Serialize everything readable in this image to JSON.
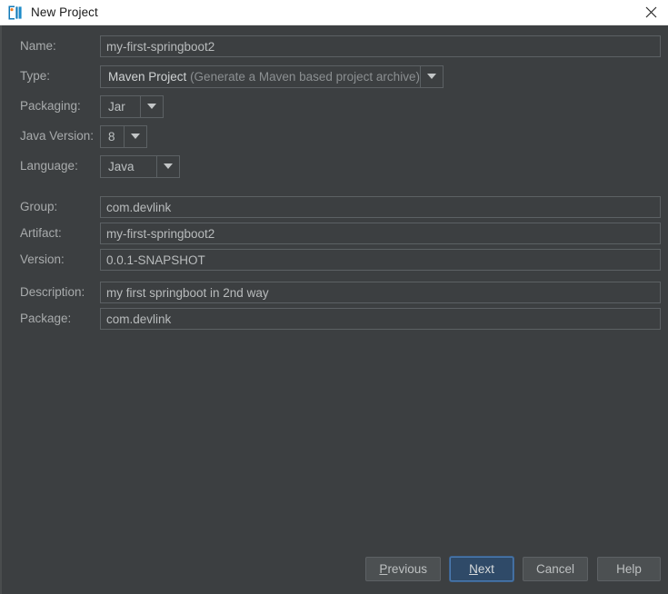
{
  "window": {
    "title": "New Project",
    "logo_icon": "intellij-idea-logo",
    "close_icon": "close-icon"
  },
  "form": {
    "fields": [
      {
        "id": "name",
        "label": "Name:",
        "kind": "text",
        "value": "my-first-springboot2",
        "placeholder": ""
      },
      {
        "id": "type",
        "label": "Type:",
        "kind": "combo",
        "value": "Maven Project",
        "value_hint": "(Generate a Maven based project archive)",
        "arrow_icon": "chevron-down-icon"
      },
      {
        "id": "packaging",
        "label": "Packaging:",
        "kind": "combo",
        "value": "Jar",
        "arrow_icon": "chevron-down-icon"
      },
      {
        "id": "java_version",
        "label": "Java Version:",
        "kind": "combo",
        "value": "8",
        "arrow_icon": "chevron-down-icon"
      },
      {
        "id": "language",
        "label": "Language:",
        "kind": "combo",
        "value": "Java",
        "arrow_icon": "chevron-down-icon"
      },
      {
        "id": "group",
        "label": "Group:",
        "kind": "text",
        "value": "com.devlink",
        "placeholder": ""
      },
      {
        "id": "artifact",
        "label": "Artifact:",
        "kind": "text",
        "value": "my-first-springboot2",
        "placeholder": ""
      },
      {
        "id": "version",
        "label": "Version:",
        "kind": "text",
        "value": "0.0.1-SNAPSHOT",
        "placeholder": ""
      },
      {
        "id": "description",
        "label": "Description:",
        "kind": "text",
        "value": "my first springboot in 2nd way",
        "placeholder": ""
      },
      {
        "id": "package",
        "label": "Package:",
        "kind": "text",
        "value": "com.devlink",
        "placeholder": ""
      }
    ]
  },
  "footer": {
    "buttons": [
      {
        "id": "previous",
        "label_pre": "",
        "label_mnemonic": "P",
        "label_post": "revious",
        "default": false
      },
      {
        "id": "next",
        "label_pre": "",
        "label_mnemonic": "N",
        "label_post": "ext",
        "default": true
      },
      {
        "id": "cancel",
        "label_pre": "Cancel",
        "label_mnemonic": "",
        "label_post": "",
        "default": false
      },
      {
        "id": "help",
        "label_pre": "Help",
        "label_mnemonic": "",
        "label_post": "",
        "default": false
      }
    ]
  },
  "colors": {
    "dialog_background": "#3c3f41",
    "titlebar_background": "#ffffff",
    "label_text": "#a8abac",
    "value_text": "#b8bbbc",
    "field_border": "#5c6164",
    "button_background": "#4c5052",
    "default_button_background": "#2f4a68",
    "focus_ring": "#4a7ab0",
    "logo_blue": "#127ab8",
    "logo_orange": "#f07e26"
  }
}
